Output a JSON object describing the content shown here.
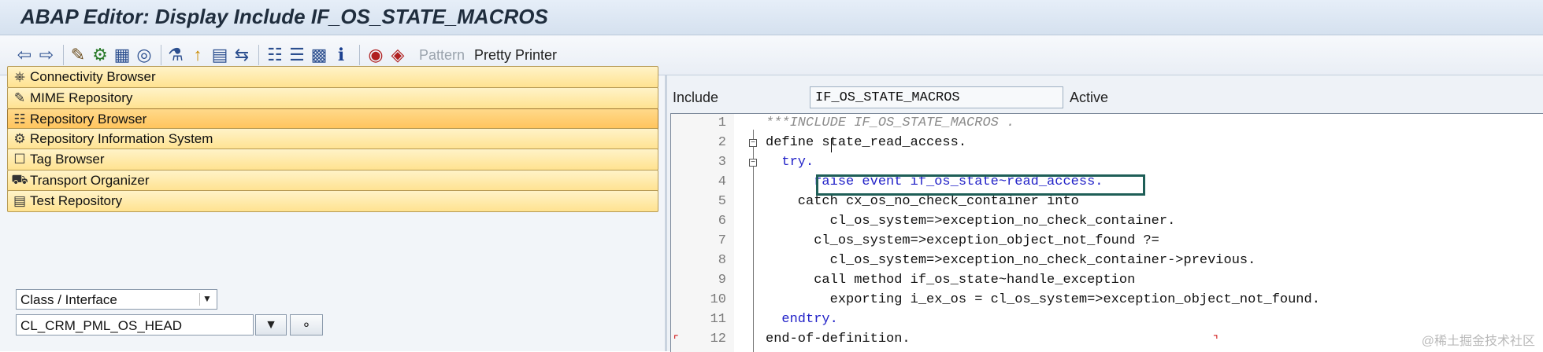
{
  "window": {
    "title": "ABAP Editor: Display Include IF_OS_STATE_MACROS"
  },
  "toolbar": {
    "icons": [
      "back-icon",
      "forward-icon",
      "display-change-icon",
      "activate-icon",
      "other-object-icon",
      "where-used-icon",
      "syntax-check-icon",
      "test-icon",
      "hierarchy-icon",
      "display-object-list-icon",
      "navigation-window-icon",
      "info-icon",
      "breakpoint-icon",
      "session-breakpoint-icon"
    ],
    "pattern_label": "Pattern",
    "pretty_printer_label": "Pretty Printer"
  },
  "navigator": {
    "items": [
      {
        "label": "Connectivity Browser",
        "icon": "connectivity-icon",
        "active": false
      },
      {
        "label": "MIME Repository",
        "icon": "mime-icon",
        "active": false
      },
      {
        "label": "Repository Browser",
        "icon": "hierarchy-icon",
        "active": true
      },
      {
        "label": "Repository Information System",
        "icon": "info-system-icon",
        "active": false
      },
      {
        "label": "Tag Browser",
        "icon": "tag-icon",
        "active": false
      },
      {
        "label": "Transport Organizer",
        "icon": "truck-icon",
        "active": false
      },
      {
        "label": "Test Repository",
        "icon": "test-repository-icon",
        "active": false
      }
    ],
    "object_type": "Class / Interface",
    "object_name": "CL_CRM_PML_OS_HEAD"
  },
  "editor": {
    "include_label": "Include",
    "include_name": "IF_OS_STATE_MACROS",
    "status": "Active",
    "lines": [
      {
        "num": "1",
        "text": "***INCLUDE IF_OS_STATE_MACROS ."
      },
      {
        "num": "2",
        "text": "define state_read_access."
      },
      {
        "num": "3",
        "text": "  try."
      },
      {
        "num": "4",
        "text": "      raise event if_os_state~read_access."
      },
      {
        "num": "5",
        "text": "    catch cx_os_no_check_container into"
      },
      {
        "num": "6",
        "text": "        cl_os_system=>exception_no_check_container."
      },
      {
        "num": "7",
        "text": "      cl_os_system=>exception_object_not_found ?="
      },
      {
        "num": "8",
        "text": "        cl_os_system=>exception_no_check_container->previous."
      },
      {
        "num": "9",
        "text": "      call method if_os_state~handle_exception"
      },
      {
        "num": "10",
        "text": "        exporting i_ex_os = cl_os_system=>exception_object_not_found."
      },
      {
        "num": "11",
        "text": "  endtry."
      },
      {
        "num": "12",
        "text": "end-of-definition."
      }
    ]
  },
  "watermark": "@稀土掘金技术社区",
  "colors": {
    "accent": "#ffe290",
    "highlight_border": "#1e5e57",
    "keyword": "#2222c8"
  }
}
